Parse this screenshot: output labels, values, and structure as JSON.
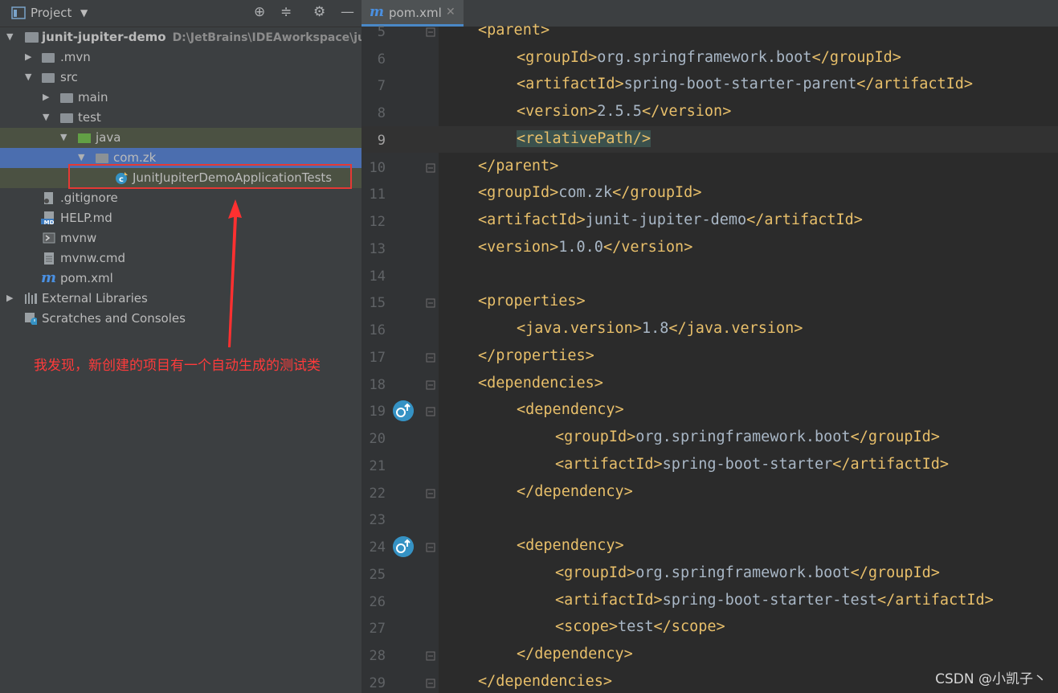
{
  "project_panel": {
    "title": "Project",
    "tree": [
      {
        "label": "junit-jupiter-demo",
        "path": "D:\\JetBrains\\IDEAworkspace\\junit-",
        "bold": true
      },
      {
        "label": ".mvn"
      },
      {
        "label": "src"
      },
      {
        "label": "main"
      },
      {
        "label": "test"
      },
      {
        "label": "java"
      },
      {
        "label": "com.zk"
      },
      {
        "label": "JunitJupiterDemoApplicationTests"
      },
      {
        "label": ".gitignore"
      },
      {
        "label": "HELP.md"
      },
      {
        "label": "mvnw"
      },
      {
        "label": "mvnw.cmd"
      },
      {
        "label": "pom.xml"
      },
      {
        "label": "External Libraries"
      },
      {
        "label": "Scratches and Consoles"
      }
    ],
    "annotation": "我发现，新创建的项目有一个自动生成的测试类"
  },
  "editor": {
    "tab_icon": "m",
    "tab_label": "pom.xml",
    "line_numbers": [
      "5",
      "6",
      "7",
      "8",
      "9",
      "10",
      "11",
      "12",
      "13",
      "14",
      "15",
      "16",
      "17",
      "18",
      "19",
      "20",
      "21",
      "22",
      "23",
      "24",
      "25",
      "26",
      "27",
      "28",
      "29"
    ],
    "lines": [
      [
        "<parent>",
        "",
        ""
      ],
      [
        "<groupId>",
        "org.springframework.boot",
        "</groupId>"
      ],
      [
        "<artifactId>",
        "spring-boot-starter-parent",
        "</artifactId>"
      ],
      [
        "<version>",
        "2.5.5",
        "</version>"
      ],
      [
        "<relativePath/>",
        "",
        ""
      ],
      [
        "</parent>",
        "",
        ""
      ],
      [
        "<groupId>",
        "com.zk",
        "</groupId>"
      ],
      [
        "<artifactId>",
        "junit-jupiter-demo",
        "</artifactId>"
      ],
      [
        "<version>",
        "1.0.0",
        "</version>"
      ],
      [
        "",
        "",
        ""
      ],
      [
        "<properties>",
        "",
        ""
      ],
      [
        "<java.version>",
        "1.8",
        "</java.version>"
      ],
      [
        "</properties>",
        "",
        ""
      ],
      [
        "<dependencies>",
        "",
        ""
      ],
      [
        "<dependency>",
        "",
        ""
      ],
      [
        "<groupId>",
        "org.springframework.boot",
        "</groupId>"
      ],
      [
        "<artifactId>",
        "spring-boot-starter",
        "</artifactId>"
      ],
      [
        "</dependency>",
        "",
        ""
      ],
      [
        "",
        "",
        ""
      ],
      [
        "<dependency>",
        "",
        ""
      ],
      [
        "<groupId>",
        "org.springframework.boot",
        "</groupId>"
      ],
      [
        "<artifactId>",
        "spring-boot-starter-test",
        "</artifactId>"
      ],
      [
        "<scope>",
        "test",
        "</scope>"
      ],
      [
        "</dependency>",
        "",
        ""
      ],
      [
        "</dependencies>",
        "",
        ""
      ]
    ]
  },
  "watermark": "CSDN @小凯子丶",
  "colors": {
    "tag": "#e8bf6a",
    "text": "#a9b7c6",
    "annotation": "#ff3b3b",
    "selection": "#4b6eaf"
  }
}
